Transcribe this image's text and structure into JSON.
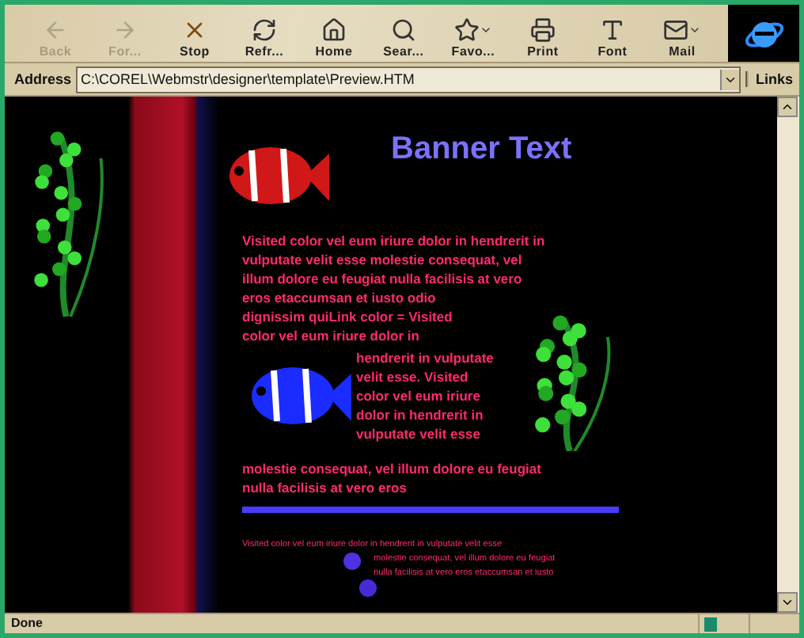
{
  "toolbar": {
    "buttons": [
      {
        "kind": "back",
        "label": "Back",
        "disabled": true,
        "menu": false
      },
      {
        "kind": "forward",
        "label": "For...",
        "disabled": true,
        "menu": false
      },
      {
        "kind": "stop",
        "label": "Stop",
        "disabled": false,
        "menu": false
      },
      {
        "kind": "refresh",
        "label": "Refr...",
        "disabled": false,
        "menu": false
      },
      {
        "kind": "home",
        "label": "Home",
        "disabled": false,
        "menu": false
      },
      {
        "kind": "search",
        "label": "Sear...",
        "disabled": false,
        "menu": false
      },
      {
        "kind": "favorites",
        "label": "Favo...",
        "disabled": false,
        "menu": true
      },
      {
        "kind": "print",
        "label": "Print",
        "disabled": false,
        "menu": false
      },
      {
        "kind": "font",
        "label": "Font",
        "disabled": false,
        "menu": false
      },
      {
        "kind": "mail",
        "label": "Mail",
        "disabled": false,
        "menu": true
      }
    ]
  },
  "address_bar": {
    "label": "Address",
    "value": "C:\\COREL\\Webmstr\\designer\\template\\Preview.HTM",
    "links": "Links"
  },
  "page": {
    "banner": "Banner Text",
    "paragraph_top": [
      "Visited color vel eum iriure dolor in hendrerit in",
      "vulputate velit esse molestie consequat, vel",
      "illum  dolore eu feugiat nulla facilisis at vero",
      "eros etaccumsan et iusto odio",
      "dignissim quiLink color = Visited",
      "color vel eum iriure dolor  in"
    ],
    "paragraph_side": [
      "hendrerit in vulputate",
      "velit esse. Visited",
      "color vel eum iriure",
      "dolor in hendrerit in",
      "vulputate velit esse"
    ],
    "paragraph_bottom": [
      "molestie consequat, vel illum dolore eu feugiat",
      "nulla facilisis at vero eros"
    ],
    "small_first": "Visited color vel eum iriure dolor in hendrerit in vulputate velit esse",
    "small_rest": [
      "molestie consequat, vel illum dolore eu feugiat",
      "nulla facilisis at vero eros  etaccumsan et iusto"
    ]
  },
  "status_bar": {
    "text": "Done"
  }
}
